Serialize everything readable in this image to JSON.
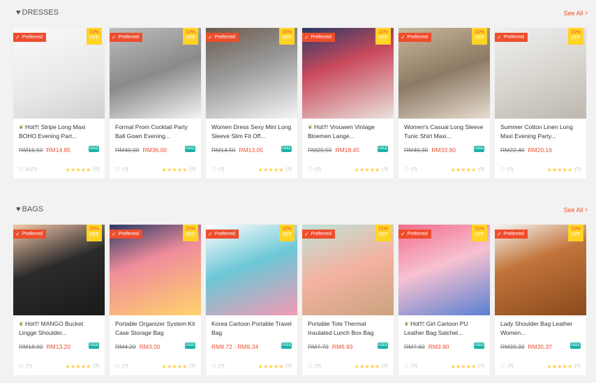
{
  "sections": [
    {
      "title": "DRESSES",
      "see_all": "See All",
      "items": [
        {
          "badge": "Preferred",
          "discount": "10%",
          "off": "OFF",
          "hot": true,
          "name": "Hot!!! Stripe Long Maxi BOHO Evening Part...",
          "orig": "RM16.50",
          "price": "RM14.85",
          "likes": "41(?)",
          "rating": "(?)",
          "ship": "FREE"
        },
        {
          "badge": "Preferred",
          "discount": "10%",
          "off": "OFF",
          "hot": false,
          "name": "Formal Prom Cocktail Party Ball Gown Evening...",
          "orig": "RM40.00",
          "price": "RM36.00",
          "likes": "(?)",
          "rating": "(?)",
          "ship": "FREE"
        },
        {
          "badge": "Preferred",
          "discount": "10%",
          "off": "OFF",
          "hot": false,
          "name": "Women Dress Sexy Mini Long Sleeve Slim Fit Off...",
          "orig": "RM14.50",
          "price": "RM13.05",
          "likes": "(?)",
          "rating": "(?)",
          "ship": "FREE"
        },
        {
          "badge": "Preferred",
          "discount": "10%",
          "off": "OFF",
          "hot": true,
          "name": "Hot!!! Vrouwen Vintage Bloemen Lange...",
          "orig": "RM20.50",
          "price": "RM18.45",
          "likes": "(?)",
          "rating": "(?)",
          "ship": "FREE"
        },
        {
          "badge": "Preferred",
          "discount": "10%",
          "off": "OFF",
          "hot": false,
          "name": "Women's Casual Long Sleeve Tunic Shirt Maxi...",
          "orig": "RM40.30",
          "price": "RM33.90",
          "likes": "(?)",
          "rating": "(?)",
          "ship": "FREE"
        },
        {
          "badge": "Preferred",
          "discount": "10%",
          "off": "OFF",
          "hot": false,
          "name": "Summer Cotton Linen Long Maxi Evening Party...",
          "orig": "RM22.40",
          "price": "RM20.16",
          "likes": "(?)",
          "rating": "(?)",
          "ship": ""
        }
      ]
    },
    {
      "title": "BAGS",
      "see_all": "See All",
      "items": [
        {
          "badge": "Preferred",
          "discount": "25%",
          "off": "OFF",
          "hot": true,
          "name": "Hot!!! MANGO Bucket Lingge Shoulder...",
          "orig": "RM18.00",
          "price": "RM13.20",
          "likes": "(?)",
          "rating": "(?)",
          "ship": "FREE"
        },
        {
          "badge": "Preferred",
          "discount": "25%",
          "off": "OFF",
          "hot": false,
          "name": "Portable Organizer System Kit Case Storage Bag",
          "orig": "RM4.20",
          "price": "RM3.00",
          "likes": "(?)",
          "rating": "(?)",
          "ship": "FREE"
        },
        {
          "badge": "Preferred",
          "discount": "10%",
          "off": "OFF",
          "hot": false,
          "name": "Korea Cartoon Portable Travel Bag",
          "orig": "",
          "price": "RM8.72 - RM9.34",
          "likes": "(?)",
          "rating": "(?)",
          "ship": "FREE"
        },
        {
          "badge": "Preferred",
          "discount": "15%",
          "off": "OFF",
          "hot": false,
          "name": "Portable Tote Thermal Insulated Lunch Box Bag",
          "orig": "RM7.70",
          "price": "RM6.93",
          "likes": "(?)",
          "rating": "(?)",
          "ship": "FREE"
        },
        {
          "badge": "Preferred",
          "discount": "10%",
          "off": "OFF",
          "hot": true,
          "name": "Hot!!! Girl Cartoon PU Leather Bag Satchel...",
          "orig": "RM7.60",
          "price": "RM3.90",
          "likes": "(?)",
          "rating": "(?)",
          "ship": "FREE"
        },
        {
          "badge": "Preferred",
          "discount": "10%",
          "off": "OFF",
          "hot": false,
          "name": "Lady Shoulder Bag Leather Women...",
          "orig": "RM39.30",
          "price": "RM35.37",
          "likes": "(?)",
          "rating": "(?)",
          "ship": "FREE"
        }
      ]
    }
  ],
  "stars": "★★★★★",
  "colors": {
    "accent": "#ee4d2d",
    "discount_bg": "#ffd424",
    "ship": "#1ab3a6",
    "background": "#f2f2f2"
  }
}
